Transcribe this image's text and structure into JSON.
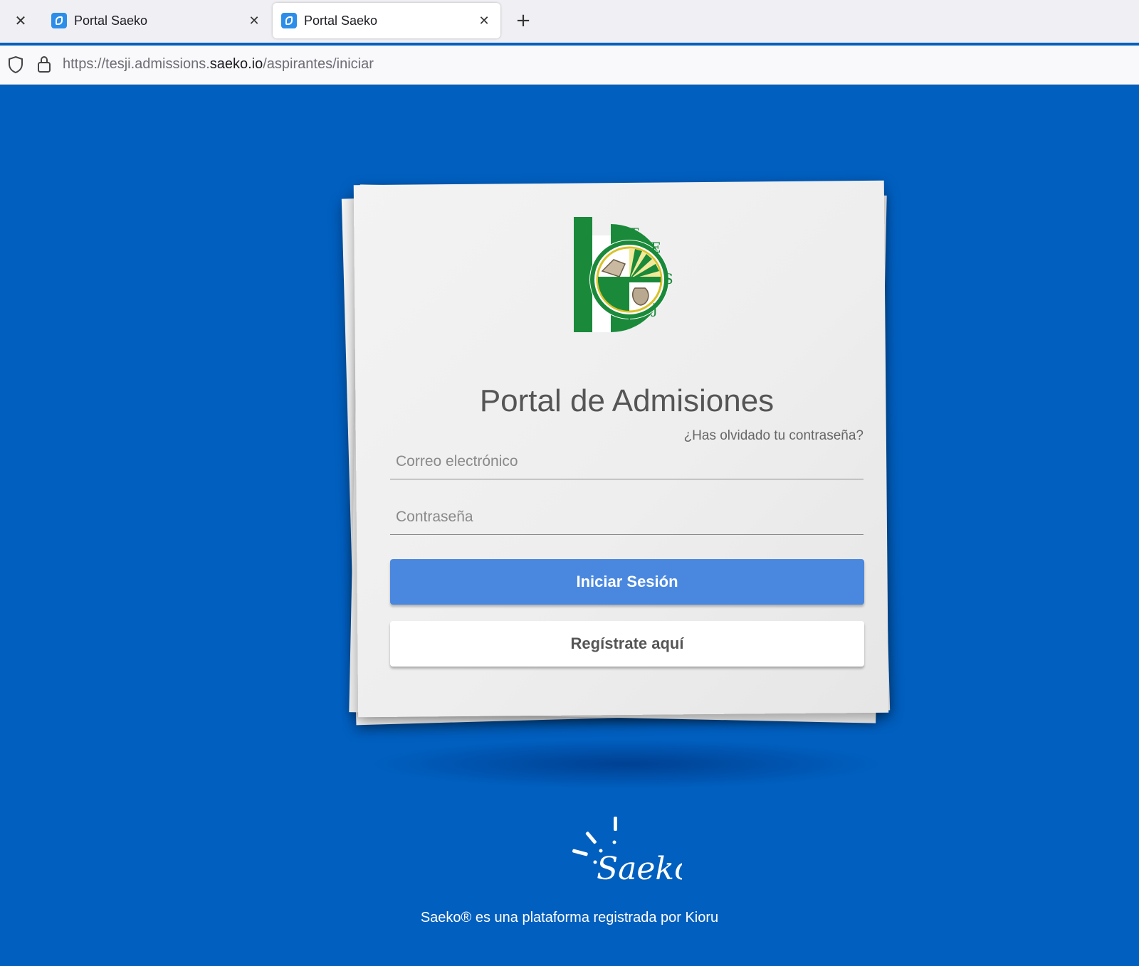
{
  "browser": {
    "tabs": [
      {
        "title": "Portal Saeko",
        "active": false
      },
      {
        "title": "Portal Saeko",
        "active": true
      }
    ],
    "url": {
      "prefix": "https://tesji.admissions.",
      "host": "saeko.io",
      "path": "/aspirantes/iniciar"
    }
  },
  "login": {
    "logo_letters": [
      "T",
      "E",
      "S",
      "J",
      "I"
    ],
    "title": "Portal de Admisiones",
    "forgot_password": "¿Has olvidado tu contraseña?",
    "email_placeholder": "Correo electrónico",
    "password_placeholder": "Contraseña",
    "login_button": "Iniciar Sesión",
    "register_button": "Regístrate aquí"
  },
  "brand": {
    "name": "Saeko",
    "footer_text": "Saeko® es una plataforma registrada por Kioru"
  },
  "colors": {
    "background": "#005fbf",
    "primary_button": "#4a88e0",
    "logo_green": "#1a8a3a",
    "logo_yellow": "#d8c228"
  }
}
